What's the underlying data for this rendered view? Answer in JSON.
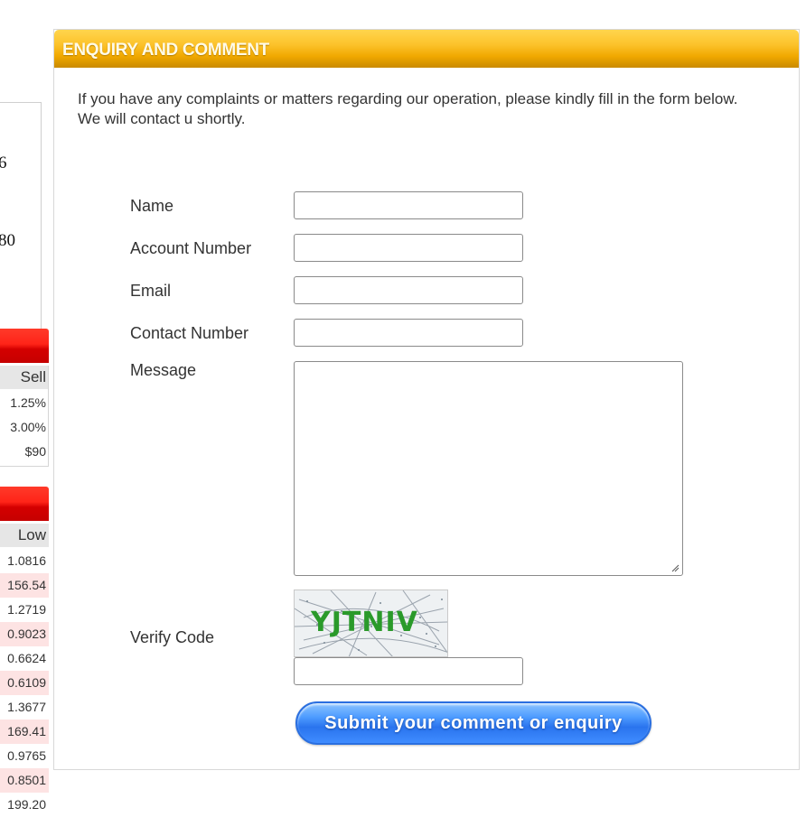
{
  "sidebar": {
    "fig_top": "6",
    "fig_bottom": "80",
    "sell_header": "Sell",
    "sell_rows": [
      "1.25%",
      "3.00%",
      "$90"
    ],
    "low_header": "Low",
    "low_rows": [
      "1.0816",
      "156.54",
      "1.2719",
      "0.9023",
      "0.6624",
      "0.6109",
      "1.3677",
      "169.41",
      "0.9765",
      "0.8501",
      "199.20"
    ]
  },
  "panel": {
    "title": "ENQUIRY AND COMMENT",
    "intro_line1": "If you have any complaints or matters regarding our operation, please kindly fill in the form below.",
    "intro_line2": "We will contact u shortly."
  },
  "form": {
    "name_label": "Name",
    "name_value": "",
    "account_label": "Account Number",
    "account_value": "",
    "email_label": "Email",
    "email_value": "",
    "contact_label": "Contact Number",
    "contact_value": "",
    "message_label": "Message",
    "message_value": "",
    "verify_label": "Verify Code",
    "captcha_text": "YJTNIV",
    "verify_value": "",
    "submit_label": "Submit your comment or enquiry"
  },
  "colors": {
    "header_gold": "#f0a800",
    "red_bar": "#e01010",
    "submit_blue": "#2a74ee",
    "highlight_pink": "#fde3e3"
  }
}
